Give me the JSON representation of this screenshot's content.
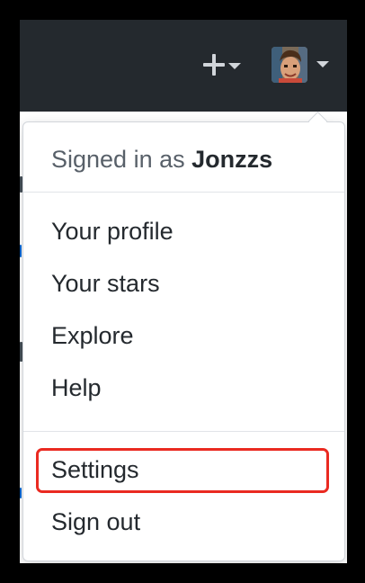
{
  "header": {
    "new_icon": "plus-icon",
    "new_caret_icon": "caret-down-icon",
    "avatar_icon": "user-avatar",
    "avatar_caret_icon": "caret-down-icon",
    "background_color": "#24292e"
  },
  "dropdown": {
    "signed_in_prefix": "Signed in as",
    "username": "Jonzzs",
    "items_group1": [
      {
        "label": "Your profile"
      },
      {
        "label": "Your stars"
      },
      {
        "label": "Explore"
      },
      {
        "label": "Help"
      }
    ],
    "items_group2": [
      {
        "label": "Settings",
        "highlighted": true
      },
      {
        "label": "Sign out"
      }
    ],
    "highlight_color": "#ea2a21"
  }
}
